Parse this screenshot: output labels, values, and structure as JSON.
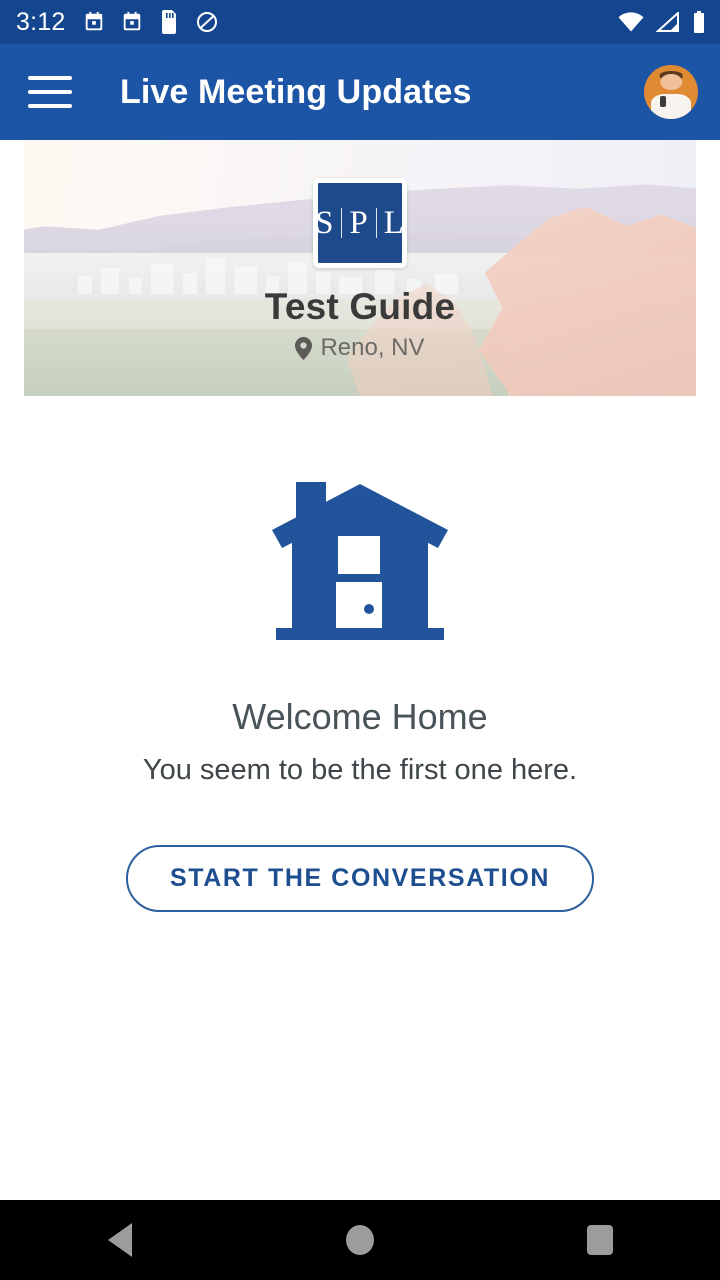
{
  "status_bar": {
    "time": "3:12",
    "left_icons": [
      "calendar-icon",
      "calendar-icon",
      "sd-card-icon",
      "do-not-disturb-icon"
    ],
    "right_icons": [
      "wifi-icon",
      "cellular-signal-icon",
      "battery-icon"
    ],
    "background_color": "#14468f"
  },
  "app_bar": {
    "menu_icon": "hamburger-menu-icon",
    "title": "Live Meeting Updates",
    "avatar_label": "user-avatar",
    "background_color": "#1c55a5",
    "text_color": "#ffffff"
  },
  "banner": {
    "logo_letters": [
      "S",
      "P",
      "L"
    ],
    "logo_color": "#1e4a8c",
    "title": "Test Guide",
    "location": "Reno, NV",
    "location_icon": "map-pin-icon",
    "photo_description": "Reno skyline with mountains and red rock formations"
  },
  "empty_state": {
    "icon": "house-icon",
    "icon_color": "#21549b",
    "title": "Welcome Home",
    "subtitle": "You seem to be the first one here.",
    "cta_label": "START THE CONVERSATION",
    "cta_color": "#1d4e8f"
  },
  "nav_bar": {
    "back_label": "back-button",
    "home_label": "home-button",
    "recents_label": "recents-button",
    "background_color": "#000000",
    "icon_color": "#9c9c9c"
  }
}
